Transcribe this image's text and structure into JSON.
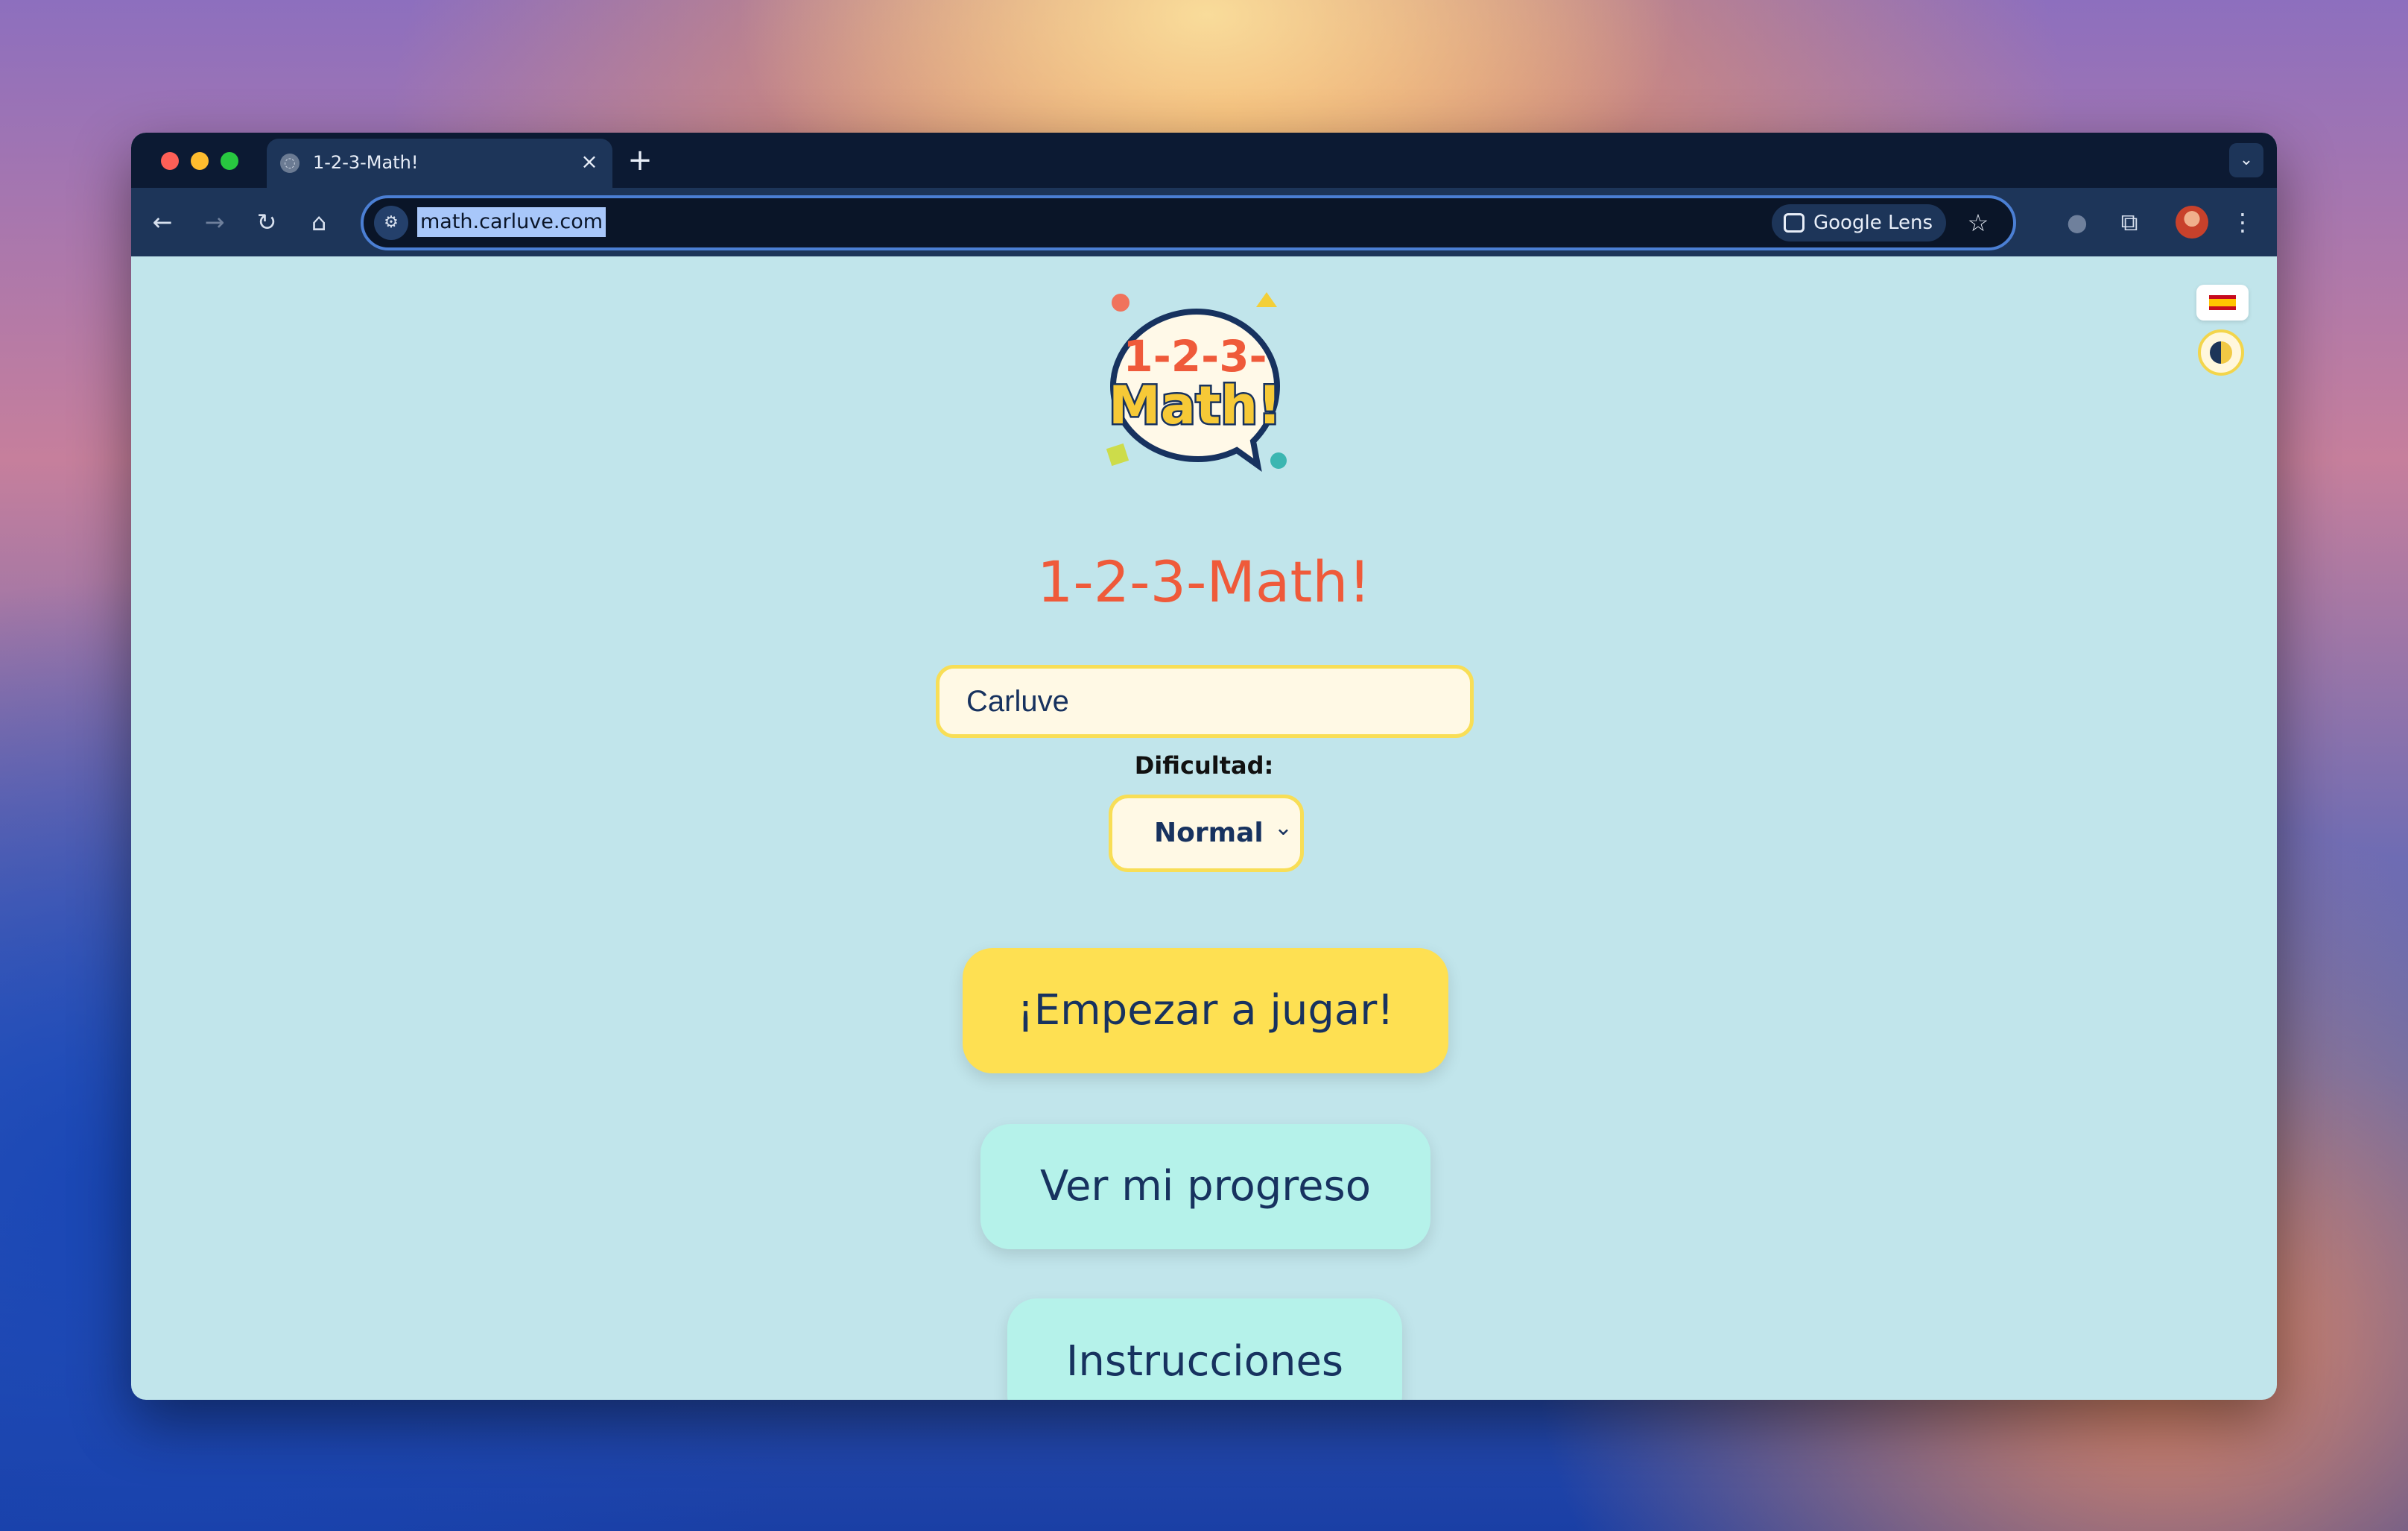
{
  "browser": {
    "tab_title": "1-2-3-Math!",
    "tab_close": "×",
    "new_tab": "+",
    "tab_menu": "⌄",
    "url": "math.carluve.com",
    "lens_label": "Google Lens",
    "icons": [
      "back-icon",
      "forward-icon",
      "reload-icon",
      "home-icon",
      "site-info-icon",
      "google-lens-icon",
      "star-icon",
      "extensions-icon",
      "profile-avatar",
      "menu-icon"
    ]
  },
  "page": {
    "logo_line1": "1-2-3-",
    "logo_line2": "Math!",
    "title": "1-2-3-Math!",
    "name_value": "Carluve",
    "difficulty_label": "Dificultad:",
    "difficulty_value": "Normal",
    "play_button": "¡Empezar a jugar!",
    "progress_button": "Ver mi progreso",
    "instructions_button": "Instrucciones"
  },
  "colors": {
    "page_bg": "#c1e5eb",
    "title": "#ef5a3a",
    "primary_button": "#fee052",
    "secondary_button": "#b5f2ea",
    "text": "#17325f"
  }
}
